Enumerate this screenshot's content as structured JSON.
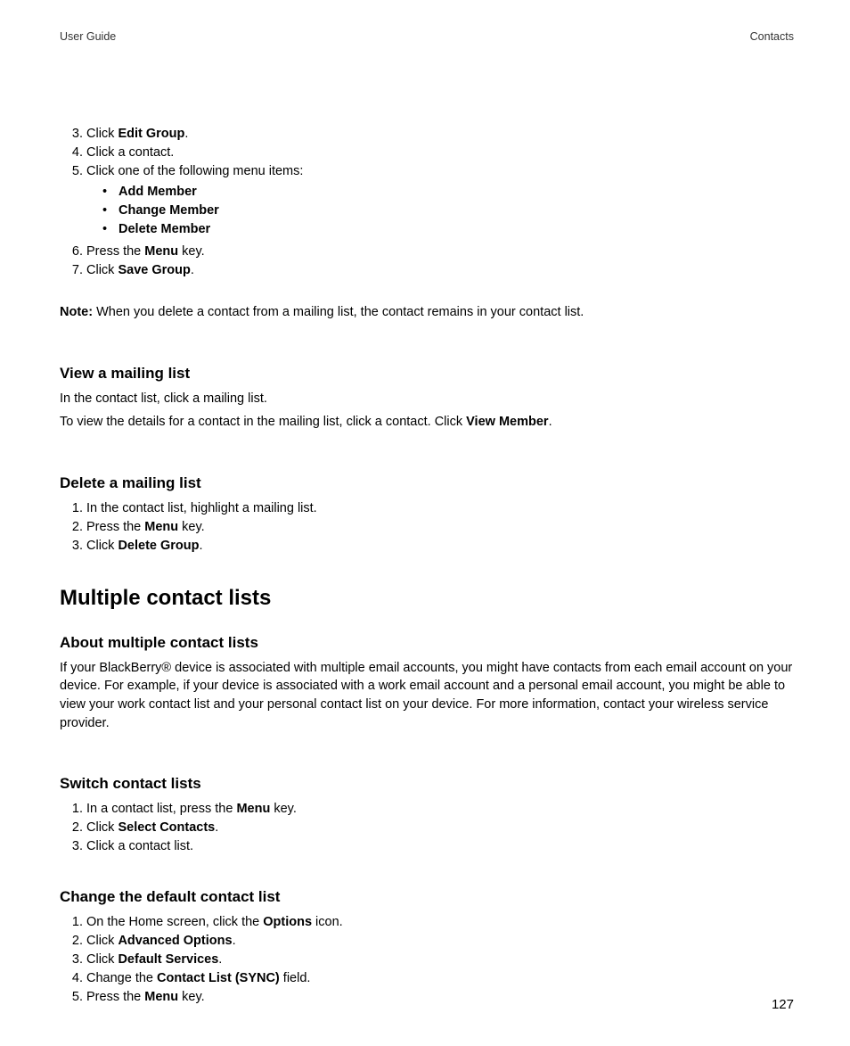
{
  "header": {
    "left": "User Guide",
    "right": "Contacts"
  },
  "ol1": {
    "start": 3,
    "items": [
      {
        "pre": "Click ",
        "b": "Edit Group",
        "post": "."
      },
      {
        "pre": "Click a contact."
      },
      {
        "pre": "Click one of the following menu items:"
      }
    ]
  },
  "sub1": [
    {
      "b": "Add Member"
    },
    {
      "b": "Change Member"
    },
    {
      "b": "Delete Member"
    }
  ],
  "ol1b": {
    "start": 6,
    "items": [
      {
        "pre": "Press the ",
        "b": "Menu",
        "post": " key."
      },
      {
        "pre": "Click ",
        "b": "Save Group",
        "post": "."
      }
    ]
  },
  "note": {
    "label": "Note:",
    "text": "  When you delete a contact from a mailing list, the contact remains in your contact list."
  },
  "h3_view": "View a mailing list",
  "p_view1": "In the contact list, click a mailing list.",
  "p_view2_pre": "To view the details for a contact in the mailing list, click a contact. Click ",
  "p_view2_b": "View Member",
  "p_view2_post": ".",
  "h3_del": "Delete a mailing list",
  "ol_del": {
    "items": [
      {
        "pre": "In the contact list, highlight a mailing list."
      },
      {
        "pre": "Press the ",
        "b": "Menu",
        "post": " key."
      },
      {
        "pre": "Click ",
        "b": "Delete Group",
        "post": "."
      }
    ]
  },
  "h2_mult": "Multiple contact lists",
  "h3_about": "About multiple contact lists",
  "p_about": "If your BlackBerry® device is associated with multiple email accounts, you might have contacts from each email account on your device. For example, if your device is associated with a work email account and a personal email account, you might be able to view your work contact list and your personal contact list on your device. For more information, contact your wireless service provider.",
  "h3_switch": "Switch contact lists",
  "ol_switch": {
    "items": [
      {
        "pre": "In a contact list, press the ",
        "b": "Menu",
        "post": " key."
      },
      {
        "pre": "Click ",
        "b": "Select Contacts",
        "post": "."
      },
      {
        "pre": "Click a contact list."
      }
    ]
  },
  "h3_change": "Change the default contact list",
  "ol_change": {
    "items": [
      {
        "pre": "On the Home screen, click the ",
        "b": "Options",
        "post": " icon."
      },
      {
        "pre": "Click ",
        "b": "Advanced Options",
        "post": "."
      },
      {
        "pre": "Click ",
        "b": "Default Services",
        "post": "."
      },
      {
        "pre": "Change the ",
        "b": "Contact List (SYNC)",
        "post": " field."
      },
      {
        "pre": "Press the ",
        "b": "Menu",
        "post": " key."
      }
    ]
  },
  "page_number": "127"
}
